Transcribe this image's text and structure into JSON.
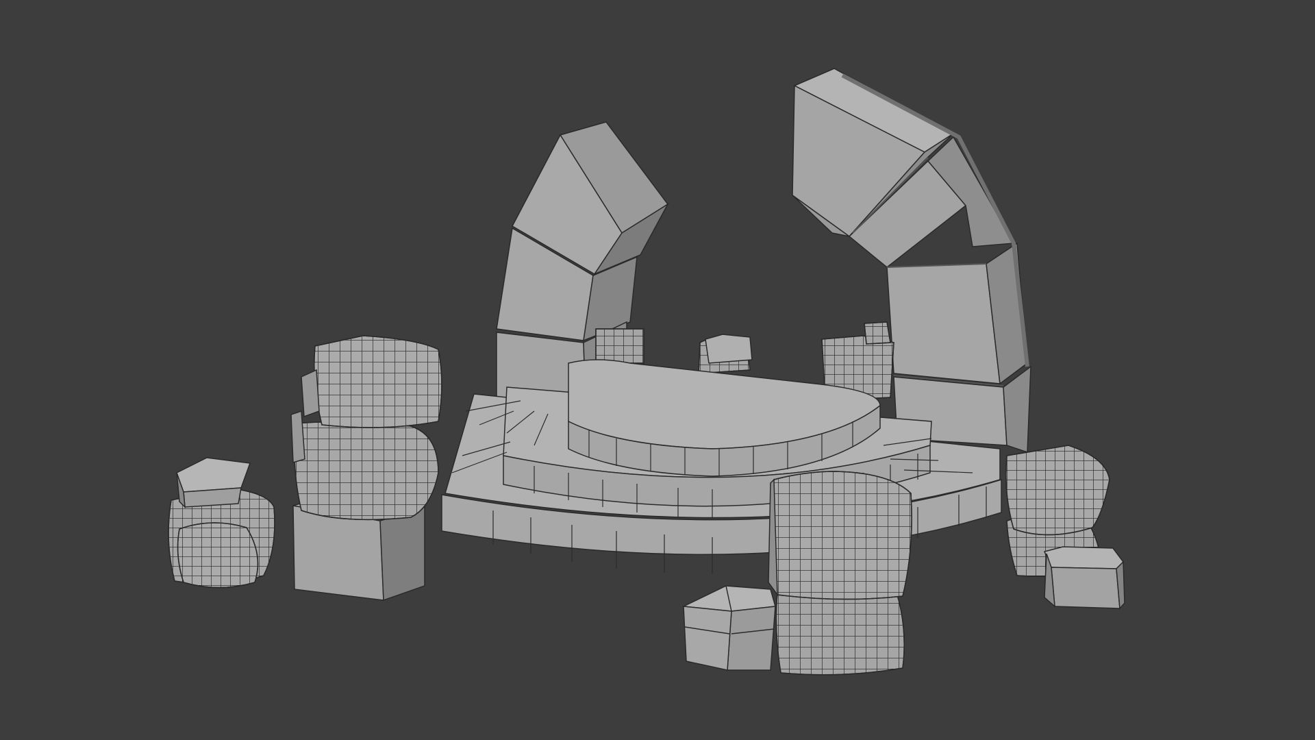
{
  "viewport": {
    "background": "#3d3d3d",
    "solid_shading_color": "#9a9a9a",
    "wire_color": "#1e1e1e"
  },
  "scene": {
    "objects": [
      "stepped-stage",
      "left-arch-segment-blocks",
      "right-arch-segment-blocks",
      "subdivided-rubble-blocks",
      "plain-rubble-blocks"
    ]
  }
}
